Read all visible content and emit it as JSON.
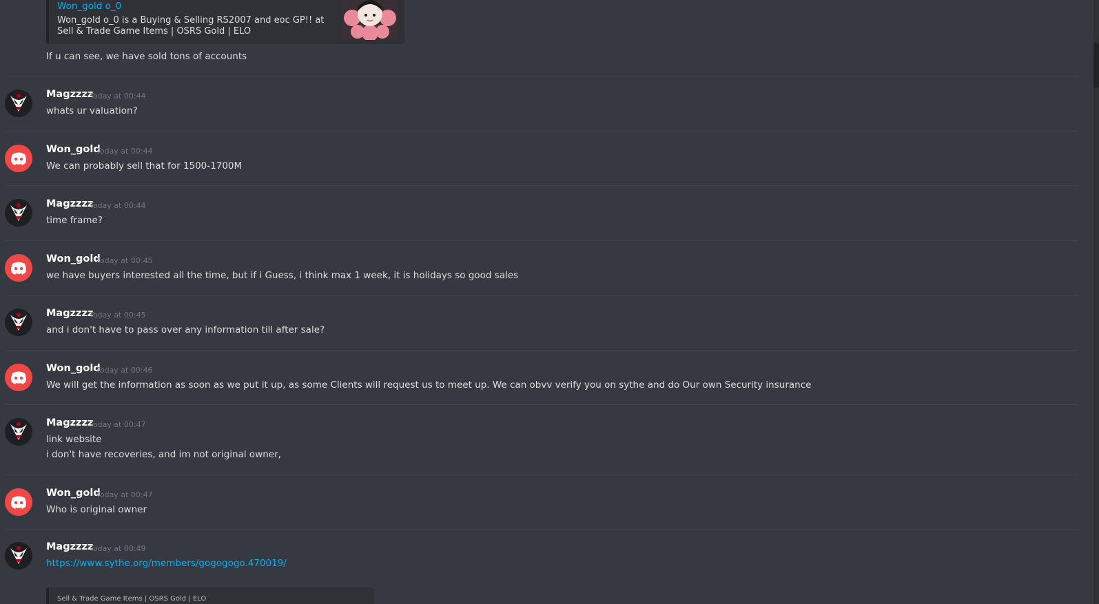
{
  "top_embed": {
    "title": "Won_gold o_0",
    "description": "Won_gold o_0 is a Buying & Selling RS2007 and eoc GP!! at Sell & Trade Game Items | OSRS Gold | ELO",
    "thumbnail_icon": "anime-girl-thumbnail"
  },
  "continuation_text": "If u can see, we have sold tons of accounts",
  "messages": [
    {
      "username": "Magzzzz",
      "timestamp": "Today at 00:44",
      "lines": [
        "whats ur valuation?"
      ],
      "avatar": "venom-avatar"
    },
    {
      "username": "Won_gold",
      "timestamp": "Today at 00:44",
      "lines": [
        "We can probably sell that for 1500-1700M"
      ],
      "avatar": "discord-avatar"
    },
    {
      "username": "Magzzzz",
      "timestamp": "Today at 00:44",
      "lines": [
        "time frame?"
      ],
      "avatar": "venom-avatar"
    },
    {
      "username": "Won_gold",
      "timestamp": "Today at 00:45",
      "lines": [
        "we have buyers interested all the time, but if i Guess, i think max 1 week, it is holidays so good sales"
      ],
      "avatar": "discord-avatar"
    },
    {
      "username": "Magzzzz",
      "timestamp": "Today at 00:45",
      "lines": [
        "and i don't have to pass over any information till after sale?"
      ],
      "avatar": "venom-avatar"
    },
    {
      "username": "Won_gold",
      "timestamp": "Today at 00:46",
      "lines": [
        "We will get the information as soon as we put it up, as some Clients will request us to meet up. We can obvv verify you on sythe and do Our own Security insurance"
      ],
      "avatar": "discord-avatar"
    },
    {
      "username": "Magzzzz",
      "timestamp": "Today at 00:47",
      "lines": [
        "link website",
        "i don't have recoveries, and im not original owner,"
      ],
      "avatar": "venom-avatar"
    },
    {
      "username": "Won_gold",
      "timestamp": "Today at 00:47",
      "lines": [
        "Who is original owner"
      ],
      "avatar": "discord-avatar"
    },
    {
      "username": "Magzzzz",
      "timestamp": "Today at 00:49",
      "lines": [
        "https://www.sythe.org/members/gogogogo.470019/"
      ],
      "avatar": "venom-avatar"
    }
  ],
  "bottom_embed": {
    "text": "Sell & Trade Game Items | OSRS Gold | ELO"
  },
  "colors": {
    "background": "#36393f",
    "link": "#00b0f4",
    "timestamp": "#72767d",
    "discord_red": "#f04747"
  }
}
